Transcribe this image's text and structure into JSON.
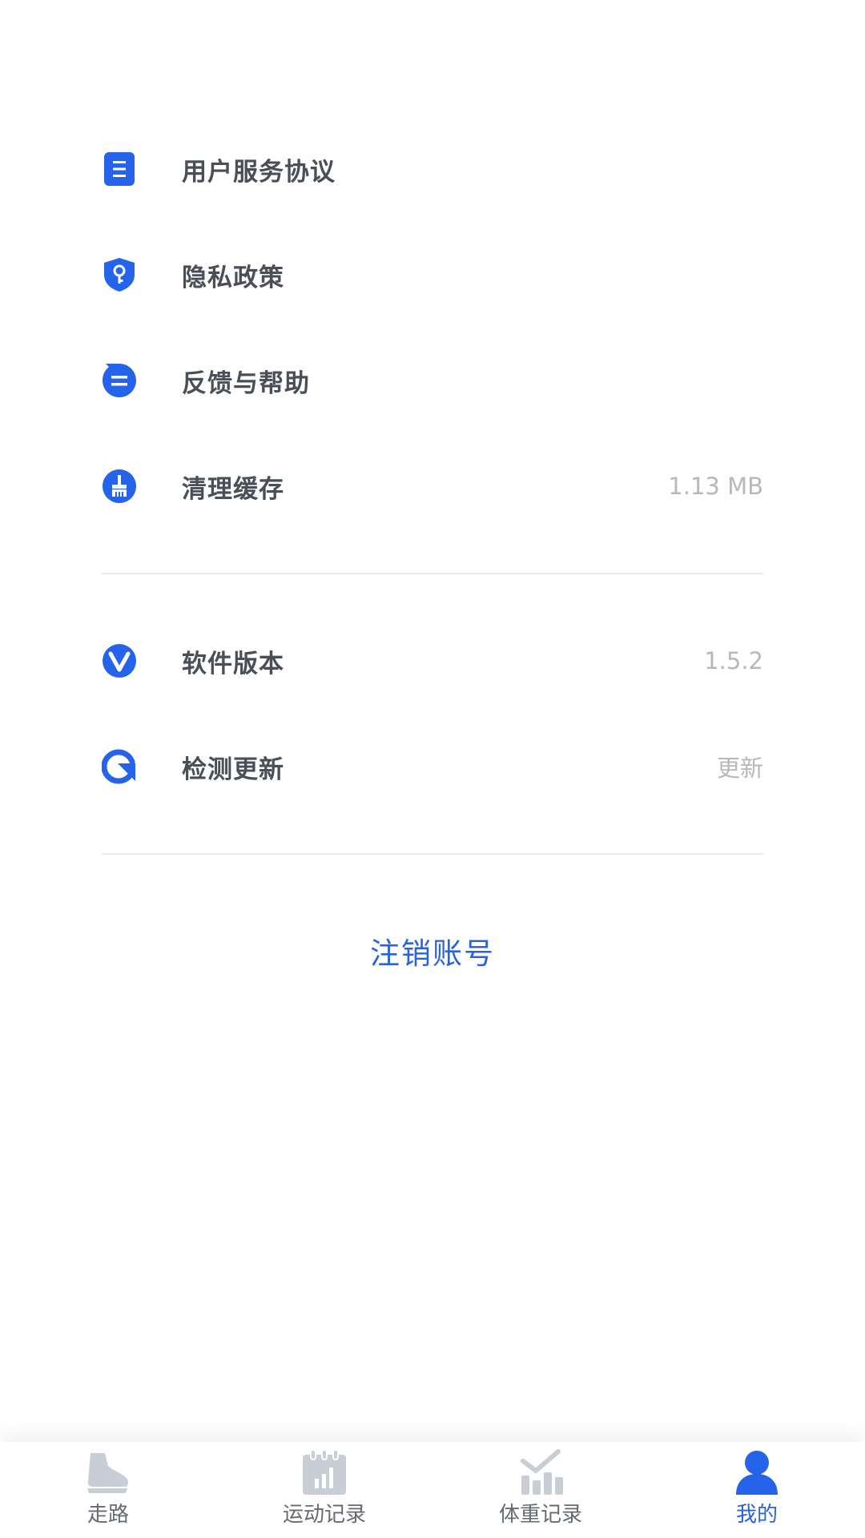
{
  "colors": {
    "accent": "#2a62e0",
    "icon_blue": "#2563eb",
    "inactive_icon": "#c9cdd6",
    "label": "#4a4e56",
    "value": "#b5b8bd",
    "divider": "#ececee"
  },
  "menu": {
    "group1": [
      {
        "icon": "document-icon",
        "label": "用户服务协议",
        "value": ""
      },
      {
        "icon": "privacy-shield-icon",
        "label": "隐私政策",
        "value": ""
      },
      {
        "icon": "feedback-bubble-icon",
        "label": "反馈与帮助",
        "value": ""
      },
      {
        "icon": "broom-icon",
        "label": "清理缓存",
        "value": "1.13 MB"
      }
    ],
    "group2": [
      {
        "icon": "version-icon",
        "label": "软件版本",
        "value": "1.5.2"
      },
      {
        "icon": "refresh-icon",
        "label": "检测更新",
        "value": "更新"
      }
    ]
  },
  "logout": {
    "label": "注销账号"
  },
  "tabbar": {
    "items": [
      {
        "icon": "shoe-icon",
        "label": "走路",
        "active": false
      },
      {
        "icon": "calendar-chart-icon",
        "label": "运动记录",
        "active": false
      },
      {
        "icon": "weight-chart-icon",
        "label": "体重记录",
        "active": false
      },
      {
        "icon": "person-icon",
        "label": "我的",
        "active": true
      }
    ]
  }
}
